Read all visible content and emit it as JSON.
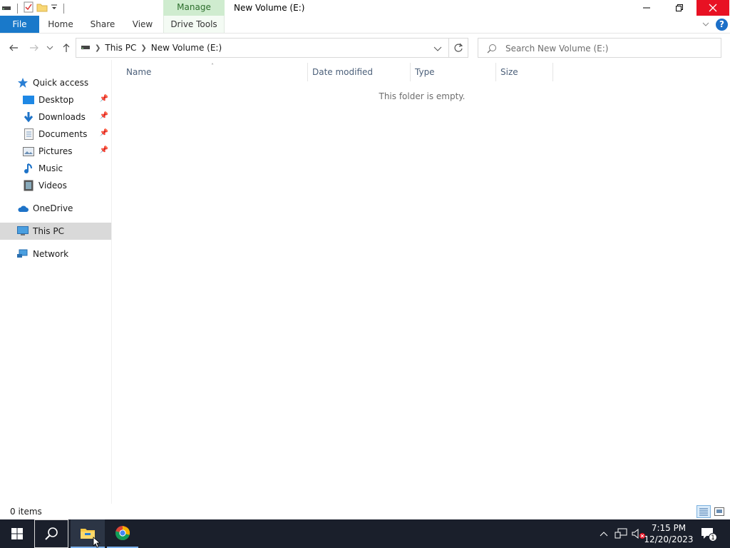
{
  "window": {
    "title": "New Volume (E:)",
    "contextual_group": "Manage"
  },
  "ribbon": {
    "tabs": [
      "File",
      "Home",
      "Share",
      "View",
      "Drive Tools"
    ],
    "help_label": "?"
  },
  "address": {
    "crumbs": [
      "This PC",
      "New Volume (E:)"
    ]
  },
  "search": {
    "placeholder": "Search New Volume (E:)"
  },
  "nav": {
    "quick_access": "Quick access",
    "items": [
      {
        "label": "Desktop",
        "icon": "desktop-icon",
        "pinned": true
      },
      {
        "label": "Downloads",
        "icon": "downloads-icon",
        "pinned": true
      },
      {
        "label": "Documents",
        "icon": "documents-icon",
        "pinned": true
      },
      {
        "label": "Pictures",
        "icon": "pictures-icon",
        "pinned": true
      },
      {
        "label": "Music",
        "icon": "music-icon",
        "pinned": false
      },
      {
        "label": "Videos",
        "icon": "videos-icon",
        "pinned": false
      }
    ],
    "onedrive": "OneDrive",
    "this_pc": "This PC",
    "network": "Network"
  },
  "columns": {
    "name": "Name",
    "date_modified": "Date modified",
    "type": "Type",
    "size": "Size"
  },
  "content": {
    "empty_message": "This folder is empty."
  },
  "status": {
    "item_count": "0 items"
  },
  "taskbar": {
    "time": "7:15 PM",
    "date": "12/20/2023",
    "notification_count": "1"
  },
  "colors": {
    "file_tab": "#1979ca",
    "manage_tab": "#cfeccf",
    "close_button": "#e81123",
    "taskbar": "#1a1f2b",
    "selected_nav": "#d9d9d9"
  }
}
